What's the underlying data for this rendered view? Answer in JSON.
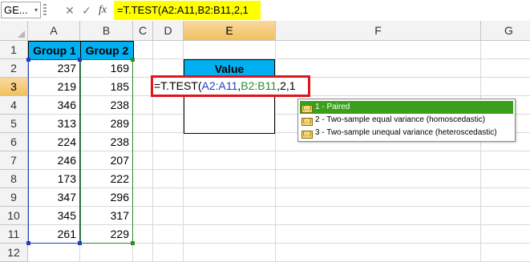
{
  "formula_bar": {
    "name_box": "GE...",
    "name_box_arrow": "▾",
    "cancel_glyph": "✕",
    "enter_glyph": "✓",
    "fx_glyph": "fx",
    "formula": "=T.TEST(A2:A11,B2:B11,2,1"
  },
  "columns": [
    "A",
    "B",
    "C",
    "D",
    "E",
    "F",
    "G"
  ],
  "rows": [
    "1",
    "2",
    "3",
    "4",
    "5",
    "6",
    "7",
    "8",
    "9",
    "10",
    "11",
    "12"
  ],
  "table": {
    "headers": [
      "Group 1",
      "Group 2"
    ],
    "group1": [
      237,
      219,
      346,
      313,
      224,
      246,
      173,
      347,
      345,
      261
    ],
    "group2": [
      169,
      185,
      238,
      289,
      238,
      207,
      222,
      296,
      317,
      229
    ]
  },
  "value_box": {
    "header": "Value"
  },
  "edit_cell": {
    "prefix": "=T.TEST(",
    "range_a": "A2:A11",
    "sep1": ",",
    "range_b": "B2:B11",
    "suffix": ",2,1"
  },
  "autocomplete": {
    "icon": "(...)",
    "items": [
      "1 - Paired",
      "2 - Two-sample equal variance (homoscedastic)",
      "3 - Two-sample unequal variance (heteroscedastic)"
    ]
  },
  "colors": {
    "header_fill": "#00b0f0",
    "formula_highlight": "#ffff00",
    "edit_border": "#e0141f",
    "range_a": "#1f3fbf",
    "range_b": "#2d8a2d",
    "selected_item": "#3aa01c"
  }
}
